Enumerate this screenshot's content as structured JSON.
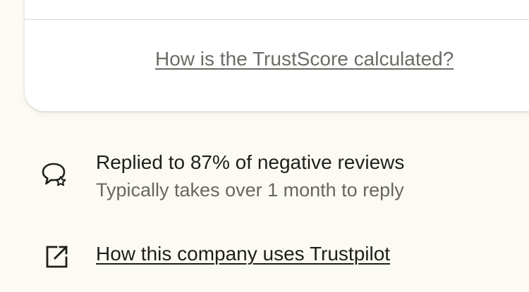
{
  "trustscore_card": {
    "link_label": "How is the TrustScore calculated?"
  },
  "reply_stats": {
    "icon": "chat-bubble-star-icon",
    "headline": "Replied to 87% of negative reviews",
    "detail": "Typically takes over 1 month to reply"
  },
  "company_usage": {
    "icon": "external-link-icon",
    "link_label": "How this company uses Trustpilot"
  },
  "colors": {
    "background": "#fcfbf3",
    "card": "#ffffff",
    "primary_text": "#1f1e1b",
    "secondary_text": "#68675f",
    "divider": "#d9d7cf"
  }
}
